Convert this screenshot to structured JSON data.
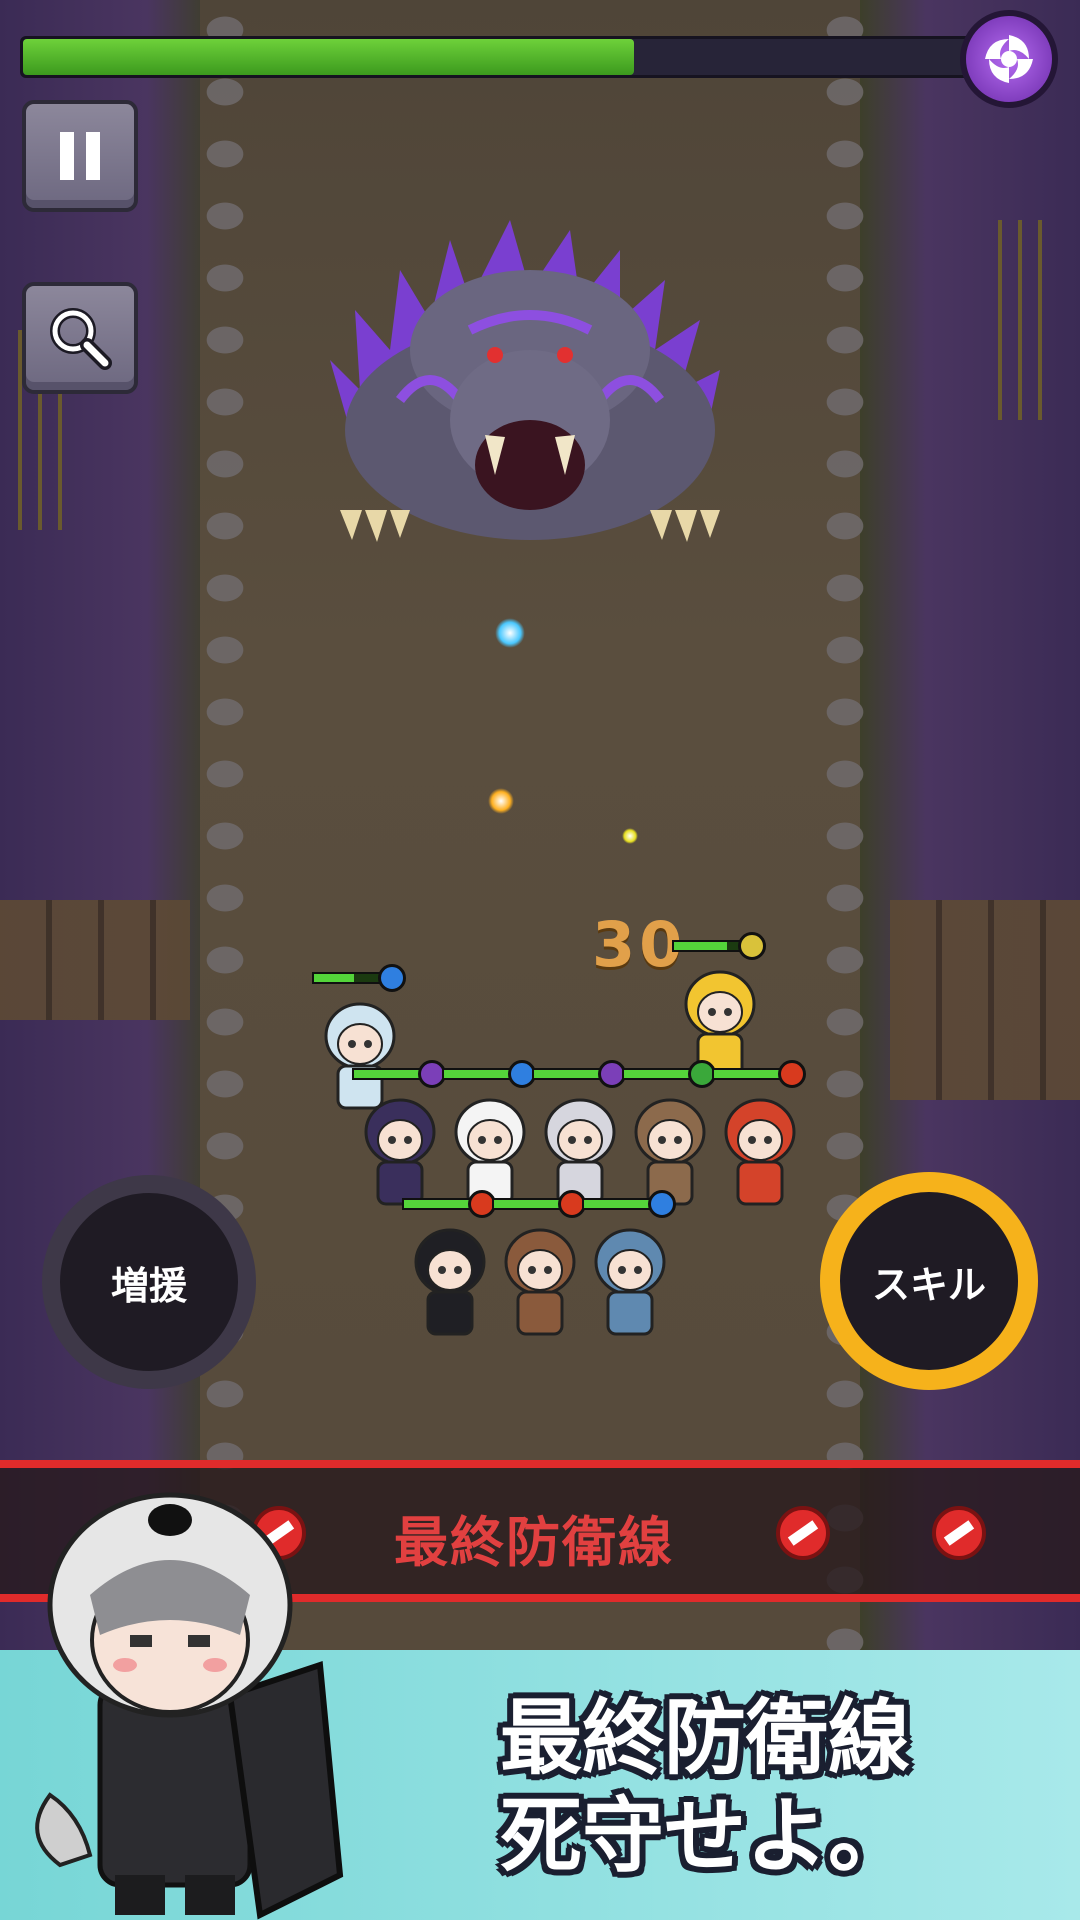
{
  "hud": {
    "boss_hp_fraction": 0.64,
    "boss_element_icon": "void-swirl-icon",
    "pause_icon": "pause-icon",
    "zoom_icon": "magnifier-icon"
  },
  "battle": {
    "damage_number": "30",
    "party": [
      {
        "name": "cat-girl",
        "hp": 0.6,
        "element": "water"
      },
      {
        "name": "bee-girl",
        "hp": 0.8,
        "element": "light"
      },
      {
        "name": "black-cat-girl",
        "hp": 1.0,
        "element": "dark"
      },
      {
        "name": "panda-girl",
        "hp": 1.0,
        "element": "water"
      },
      {
        "name": "mouse-girl",
        "hp": 1.0,
        "element": "dark"
      },
      {
        "name": "capybara-girl",
        "hp": 1.0,
        "element": "nature"
      },
      {
        "name": "dragon-girl",
        "hp": 1.0,
        "element": "fire"
      },
      {
        "name": "shadow-cat-girl",
        "hp": 1.0,
        "element": "fire"
      },
      {
        "name": "bear-maid-girl",
        "hp": 1.0,
        "element": "fire"
      },
      {
        "name": "otter-girl",
        "hp": 1.0,
        "element": "water"
      }
    ]
  },
  "controls": {
    "reinforce_label": "増援",
    "skill_label": "スキル",
    "skill_charge": 1.0
  },
  "defense_line": {
    "title": "最終防衛線"
  },
  "banner": {
    "line1": "最終防衛線",
    "line2": "死守せよ。"
  },
  "colors": {
    "hp_green": "#54d43a",
    "danger_red": "#e02b2b",
    "skill_gold": "#f6b21b",
    "banner_teal": "#8fe0e0",
    "element": {
      "water": "#2f7fe0",
      "light": "#d9c23a",
      "dark": "#7b3fb8",
      "nature": "#3aa83a",
      "fire": "#d83a1e"
    }
  }
}
